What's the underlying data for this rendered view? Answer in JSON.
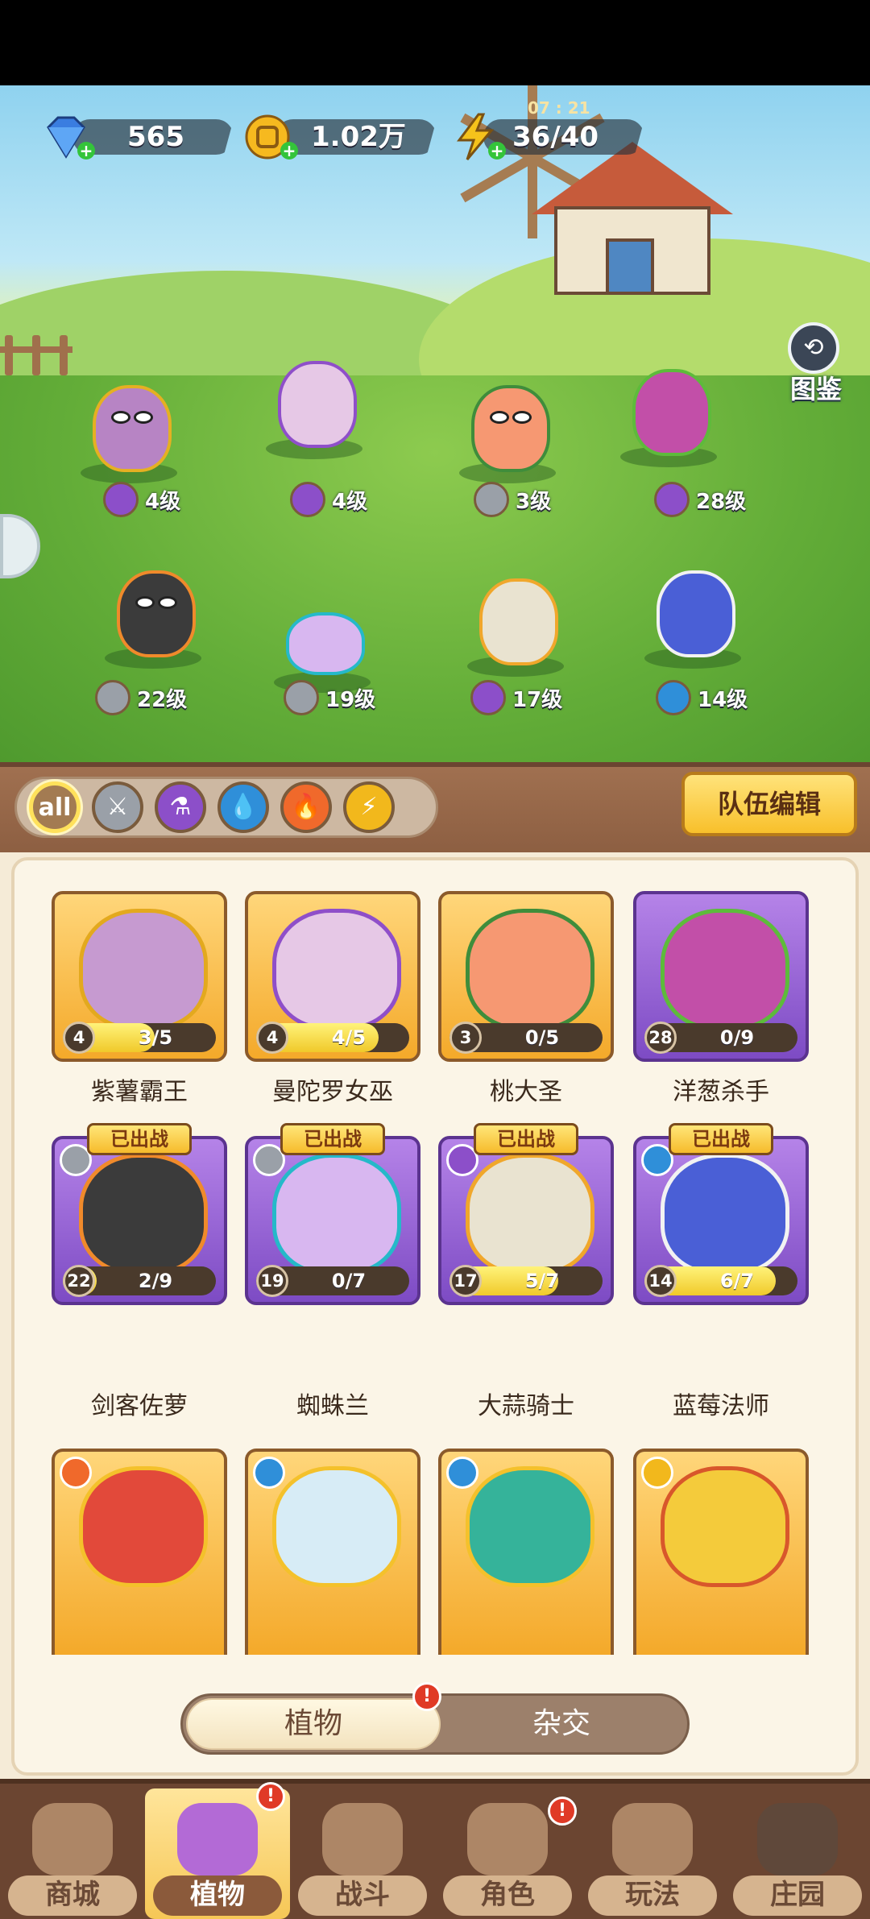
{
  "currency": {
    "gems": "565",
    "coins": "1.02万",
    "energy": "36/40",
    "energy_timer": "07 : 21"
  },
  "atlas_label": "图鉴",
  "field_heroes": [
    {
      "name": "紫薯霸王",
      "level": "4级",
      "type": "potion-icon"
    },
    {
      "name": "曼陀罗女巫",
      "level": "4级",
      "type": "potion-icon"
    },
    {
      "name": "桃大圣",
      "level": "3级",
      "type": "sword-icon"
    },
    {
      "name": "洋葱杀手",
      "level": "28级",
      "type": "potion-icon"
    },
    {
      "name": "剑客佐萝",
      "level": "22级",
      "type": "sword-icon"
    },
    {
      "name": "蜘蛛兰",
      "level": "19级",
      "type": "sword-icon"
    },
    {
      "name": "大蒜骑士",
      "level": "17级",
      "type": "potion-icon"
    },
    {
      "name": "蓝莓法师",
      "level": "14级",
      "type": "water-icon"
    }
  ],
  "filters": [
    {
      "label": "all",
      "icon": "all-icon",
      "color": "#a37b52"
    },
    {
      "label": "",
      "icon": "sword-icon",
      "color": "#9aa0a8"
    },
    {
      "label": "",
      "icon": "potion-icon",
      "color": "#8c4fc9"
    },
    {
      "label": "",
      "icon": "water-icon",
      "color": "#2f8fd9"
    },
    {
      "label": "",
      "icon": "fire-icon",
      "color": "#f0692b"
    },
    {
      "label": "",
      "icon": "lightning-icon",
      "color": "#f2b81c"
    }
  ],
  "team_edit_label": "队伍编辑",
  "cards_row1": [
    {
      "name": "紫薯霸王",
      "level": "4",
      "progress": "3/5",
      "ratio": 0.6
    },
    {
      "name": "曼陀罗女巫",
      "level": "4",
      "progress": "4/5",
      "ratio": 0.8
    },
    {
      "name": "桃大圣",
      "level": "3",
      "progress": "0/5",
      "ratio": 0.0
    },
    {
      "name": "洋葱杀手",
      "level": "28",
      "progress": "0/9",
      "ratio": 0.0
    }
  ],
  "cards_row2": [
    {
      "name": "剑客佐萝",
      "level": "22",
      "progress": "2/9",
      "ratio": 0.22
    },
    {
      "name": "蜘蛛兰",
      "level": "19",
      "progress": "0/7",
      "ratio": 0.0
    },
    {
      "name": "大蒜骑士",
      "level": "17",
      "progress": "5/7",
      "ratio": 0.71
    },
    {
      "name": "蓝莓法师",
      "level": "14",
      "progress": "6/7",
      "ratio": 0.86
    }
  ],
  "deployed_label": "已出战",
  "toggle": {
    "plants": "植物",
    "hybrid": "杂交"
  },
  "alert_mark": "!",
  "nav": [
    {
      "label": "商城",
      "icon": "shop-icon"
    },
    {
      "label": "植物",
      "icon": "plants-icon"
    },
    {
      "label": "战斗",
      "icon": "battle-icon"
    },
    {
      "label": "角色",
      "icon": "character-icon"
    },
    {
      "label": "玩法",
      "icon": "gameplay-icon"
    },
    {
      "label": "庄园",
      "icon": "manor-lock-icon"
    }
  ]
}
